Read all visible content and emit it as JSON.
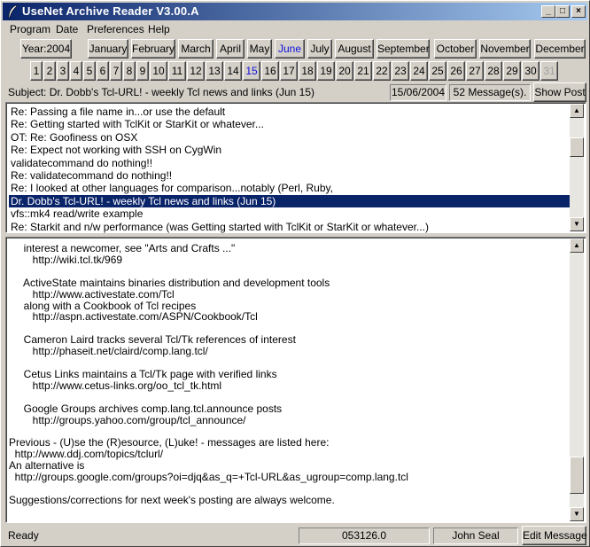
{
  "window": {
    "title": "UseNet Archive Reader V3.00.A",
    "controls": {
      "minimize": "_",
      "maximize": "□",
      "close": "×"
    }
  },
  "menu": [
    {
      "label": "Program",
      "accel": "P"
    },
    {
      "label": "Date",
      "accel": "D"
    },
    {
      "label": "Preferences",
      "accel": "P"
    },
    {
      "label": "Help",
      "accel": "H"
    }
  ],
  "year_button": "Year:2004",
  "months": [
    "January",
    "February",
    "March",
    "April",
    "May",
    "June",
    "July",
    "August",
    "September",
    "October",
    "November",
    "December"
  ],
  "selected_month": "June",
  "days": [
    "1",
    "2",
    "3",
    "4",
    "5",
    "6",
    "7",
    "8",
    "9",
    "10",
    "11",
    "12",
    "13",
    "14",
    "15",
    "16",
    "17",
    "18",
    "19",
    "20",
    "21",
    "22",
    "23",
    "24",
    "25",
    "26",
    "27",
    "28",
    "29",
    "30",
    "31"
  ],
  "selected_day": "15",
  "disabled_day": "31",
  "subject": {
    "text": "Subject: Dr. Dobb's Tcl-URL! - weekly Tcl news and links (Jun 15)",
    "date": "15/06/2004",
    "count": "52 Message(s).",
    "show_post": "Show Post"
  },
  "thread_list": [
    "Re: Passing a file name in...or use the default",
    "Re: Getting started with TclKit or StarKit or whatever...",
    "OT: Re: Goofiness on OSX",
    "Re: Expect not working with SSH on CygWin",
    "validatecommand do nothing!!",
    "Re: validatecommand do nothing!!",
    "Re: I looked at other languages for comparison...notably (Perl, Ruby,",
    "Dr. Dobb's Tcl-URL! - weekly Tcl news and links (Jun 15)",
    "vfs::mk4 read/write example",
    "Re: Starkit and n/w performance (was Getting started with TclKit or StarKit or whatever...)"
  ],
  "selected_thread_index": 7,
  "message_lines": [
    "     interest a newcomer, see \"Arts and Crafts ...\"",
    "        http://wiki.tcl.tk/969",
    "",
    "     ActiveState maintains binaries distribution and development tools",
    "        http://www.activestate.com/Tcl",
    "     along with a Cookbook of Tcl recipes",
    "        http://aspn.activestate.com/ASPN/Cookbook/Tcl",
    "",
    "     Cameron Laird tracks several Tcl/Tk references of interest",
    "        http://phaseit.net/claird/comp.lang.tcl/",
    "",
    "     Cetus Links maintains a Tcl/Tk page with verified links",
    "        http://www.cetus-links.org/oo_tcl_tk.html",
    "",
    "     Google Groups archives comp.lang.tcl.announce posts",
    "        http://groups.yahoo.com/group/tcl_announce/",
    "",
    "Previous - (U)se the (R)esource, (L)uke! - messages are listed here:",
    "  http://www.ddj.com/topics/tclurl/",
    "An alternative is",
    "  http://groups.google.com/groups?oi=djq&as_q=+Tcl-URL&as_ugroup=comp.lang.tcl",
    "",
    "Suggestions/corrections for next week's posting are always welcome."
  ],
  "status": {
    "state": "Ready",
    "message_id": "053126.0",
    "author": "John Seal",
    "edit_button": "Edit Message"
  },
  "colors": {
    "face": "#d4d0c8",
    "selection": "#0a246a",
    "title_gradient_start": "#0a246a",
    "title_gradient_end": "#a6caf0",
    "active_link": "#1010e0"
  }
}
